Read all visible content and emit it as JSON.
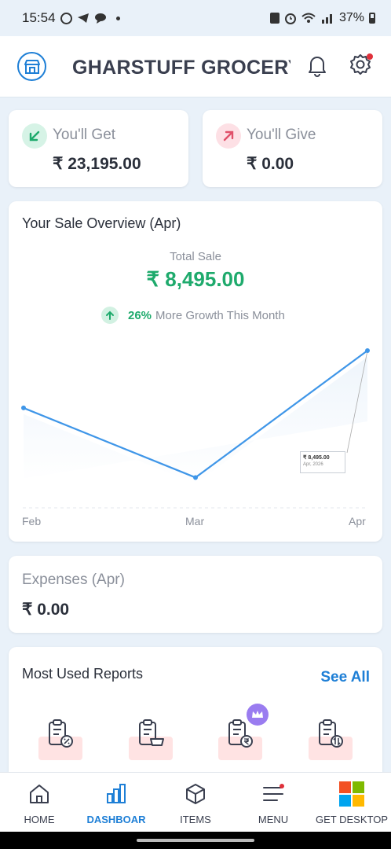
{
  "status_bar": {
    "time": "15:54",
    "battery": "37%"
  },
  "header": {
    "title": "GHARSTUFF GROCERY"
  },
  "summary": {
    "get": {
      "label": "You'll Get",
      "value": "₹ 23,195.00"
    },
    "give": {
      "label": "You'll Give",
      "value": "₹ 0.00"
    }
  },
  "overview": {
    "title": "Your Sale Overview (Apr)",
    "total_label": "Total Sale",
    "total_value": "₹ 8,495.00",
    "growth_pct": "26%",
    "growth_text": "More Growth This Month"
  },
  "chart_data": {
    "type": "line",
    "categories": [
      "Feb",
      "Mar",
      "Apr"
    ],
    "series": [
      {
        "values": [
          5200,
          1200,
          8495
        ]
      }
    ],
    "tooltip": {
      "value": "₹ 8,495.00",
      "date": "Apr, 2026"
    },
    "ylim": [
      0,
      8495
    ],
    "grid": false,
    "colors": {
      "line": "#3f96e8",
      "area": "#dceaf8"
    }
  },
  "expenses": {
    "label": "Expenses (Apr)",
    "value": "₹ 0.00"
  },
  "reports": {
    "title": "Most Used Reports",
    "see_all": "See All",
    "items": [
      {
        "icon": "report-discount-icon"
      },
      {
        "icon": "report-cart-icon"
      },
      {
        "icon": "report-rupee-icon",
        "premium": true
      },
      {
        "icon": "report-transfer-icon"
      }
    ]
  },
  "nav": {
    "items": [
      {
        "label": "HOME",
        "icon": "home-icon"
      },
      {
        "label": "DASHBOAR",
        "icon": "dashboard-icon",
        "active": true
      },
      {
        "label": "ITEMS",
        "icon": "box-icon"
      },
      {
        "label": "MENU",
        "icon": "menu-icon"
      },
      {
        "label": "GET DESKTOP",
        "icon": "windows-icon"
      }
    ]
  },
  "colors": {
    "accent": "#1e7fd6",
    "positive": "#1eaa6c",
    "negative": "#e0506a"
  }
}
